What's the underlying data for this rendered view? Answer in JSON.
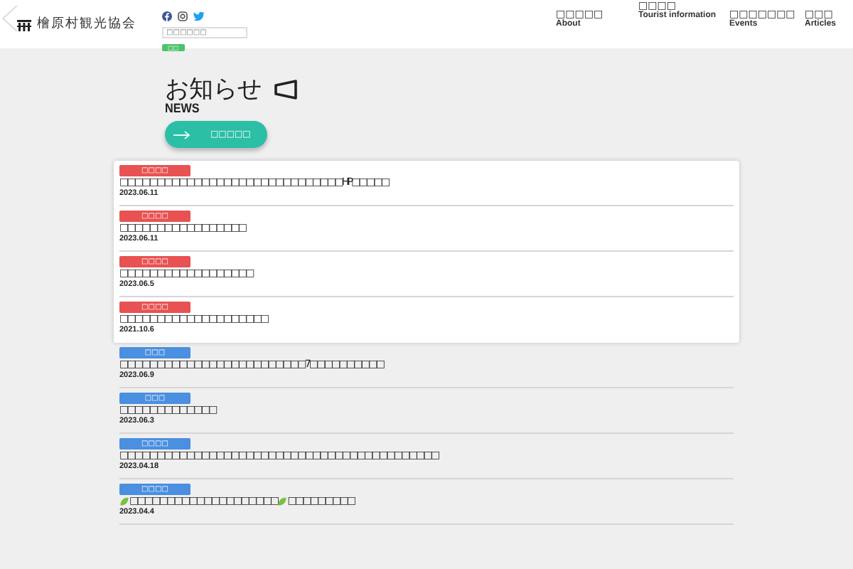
{
  "header": {
    "logo": "檜原村観光協会",
    "search": {
      "placeholder": "□□□□□□"
    },
    "search_button": "□□",
    "nav": [
      {
        "label": "□□□□□",
        "sub": "About"
      },
      {
        "label": "□□□□",
        "sub": "Tourist information"
      },
      {
        "label": "□□□□□□□",
        "sub": "Events"
      },
      {
        "label": "□□□",
        "sub": "Articles"
      }
    ]
  },
  "heading": {
    "title": "お知らせ",
    "subtitle": "NEWS",
    "button": "□□□□□"
  },
  "news": [
    {
      "pinned": true,
      "color": "#e85252",
      "tag": "□□□□",
      "date": "2023.06.11",
      "parts": [
        {
          "kind": "text",
          "text": "□□□□□□□□□□□□□□□□□□□□□□□□□□□□□□HP□□□□□"
        }
      ]
    },
    {
      "pinned": true,
      "color": "#e85252",
      "tag": "□□□□",
      "date": "2023.06.11",
      "parts": [
        {
          "kind": "text",
          "text": "□□□□□□□□□□□□□□□□□"
        }
      ]
    },
    {
      "pinned": true,
      "color": "#e85252",
      "tag": "□□□□",
      "date": "2023.06.5",
      "parts": [
        {
          "kind": "text",
          "text": "□□□□□□□□□□□□□□□□□□"
        }
      ]
    },
    {
      "pinned": true,
      "color": "#e85252",
      "tag": "□□□□",
      "date": "2021.10.6",
      "parts": [
        {
          "kind": "text",
          "text": "□□□□□□□□□□□□□□□□□□□□"
        }
      ]
    },
    {
      "pinned": false,
      "color": "#4a8fe0",
      "tag": "□□□",
      "date": "2023.06.9",
      "parts": [
        {
          "kind": "text",
          "text": "□□□□□□□□□□□□□□□□□□□□□□□□□7□□□□□□□□□□"
        }
      ]
    },
    {
      "pinned": false,
      "color": "#4a8fe0",
      "tag": "□□□",
      "date": "2023.06.3",
      "parts": [
        {
          "kind": "text",
          "text": "□□□□□□□□□□□□□"
        }
      ]
    },
    {
      "pinned": false,
      "color": "#4a8fe0",
      "tag": "□□□□",
      "date": "2023.04.18",
      "parts": [
        {
          "kind": "text",
          "text": "□□□□□□□□□□□□□□□□□□□□□□□□□□□□□□□□□□□□□□□□□□□"
        }
      ]
    },
    {
      "pinned": false,
      "color": "#4a8fe0",
      "tag": "□□□□",
      "date": "2023.04.4",
      "parts": [
        {
          "kind": "icon"
        },
        {
          "kind": "text",
          "text": "□□□□□□□□□□□□□□□□□□□□"
        },
        {
          "kind": "icon"
        },
        {
          "kind": "text",
          "text": "□□□□□□□□□"
        }
      ]
    }
  ]
}
